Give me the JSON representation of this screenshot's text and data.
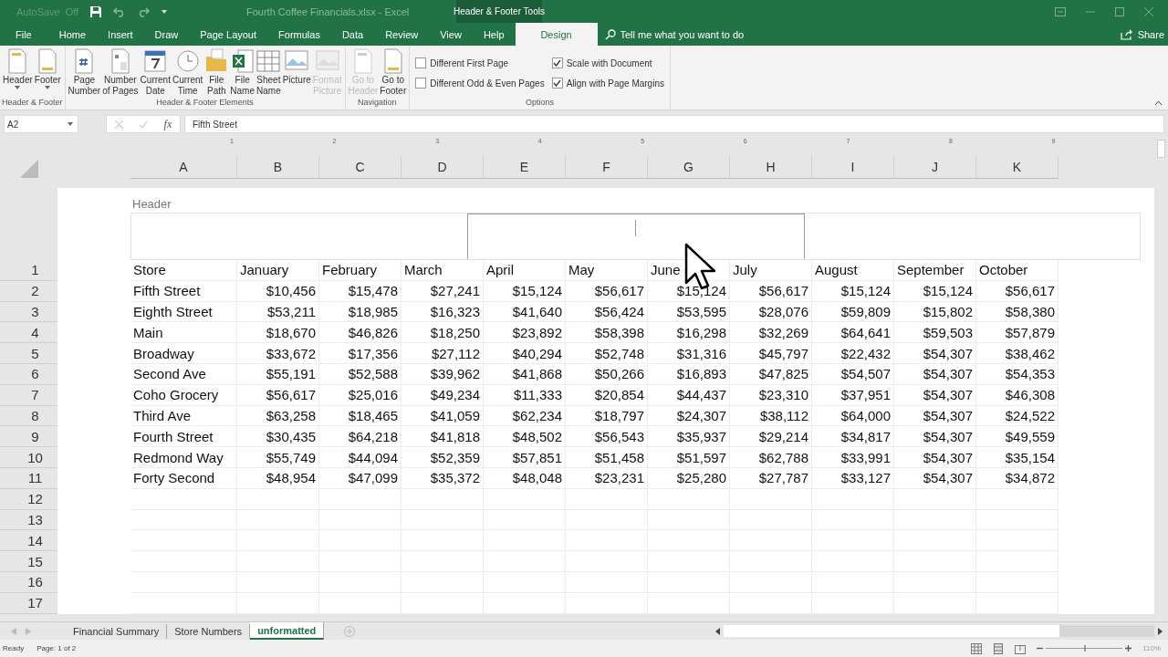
{
  "title_bar": {
    "autosave": {
      "label": "AutoSave",
      "state": "Off"
    },
    "title": "Fourth Coffee Financials.xlsx  -  Excel",
    "context": "Header & Footer Tools"
  },
  "tabs": [
    {
      "label": "File",
      "selected": false
    },
    {
      "label": "Home",
      "selected": false
    },
    {
      "label": "Insert",
      "selected": false
    },
    {
      "label": "Draw",
      "selected": false
    },
    {
      "label": "Page Layout",
      "selected": false
    },
    {
      "label": "Formulas",
      "selected": false
    },
    {
      "label": "Data",
      "selected": false
    },
    {
      "label": "Review",
      "selected": false
    },
    {
      "label": "View",
      "selected": false
    },
    {
      "label": "Help",
      "selected": false
    },
    {
      "label": "Design",
      "selected": true
    }
  ],
  "tell_me": {
    "placeholder": "Tell me what you want to do"
  },
  "share": "Share",
  "ribbon": {
    "groups": [
      {
        "label": "Header & Footer",
        "buttons": [
          {
            "label": "Header",
            "dropdown": true,
            "disabled": false
          },
          {
            "label": "Footer",
            "dropdown": true,
            "disabled": false
          }
        ]
      },
      {
        "label": "Header & Footer Elements",
        "buttons": [
          {
            "label": "Page\nNumber",
            "dropdown": false,
            "disabled": false
          },
          {
            "label": "Number\nof Pages",
            "dropdown": false,
            "disabled": false
          },
          {
            "label": "Current\nDate",
            "dropdown": false,
            "disabled": false
          },
          {
            "label": "Current\nTime",
            "dropdown": false,
            "disabled": false
          },
          {
            "label": "File\nPath",
            "dropdown": false,
            "disabled": false
          },
          {
            "label": "File\nName",
            "dropdown": false,
            "disabled": false
          },
          {
            "label": "Sheet\nName",
            "dropdown": false,
            "disabled": false
          },
          {
            "label": "Picture",
            "dropdown": false,
            "disabled": false
          },
          {
            "label": "Format\nPicture",
            "dropdown": false,
            "disabled": true
          }
        ]
      },
      {
        "label": "Navigation",
        "buttons": [
          {
            "label": "Go to\nHeader",
            "dropdown": false,
            "disabled": true
          },
          {
            "label": "Go to\nFooter",
            "dropdown": false,
            "disabled": false
          }
        ]
      }
    ],
    "options": {
      "label": "Options",
      "checks": [
        {
          "label": "Different First Page",
          "checked": false
        },
        {
          "label": "Different Odd & Even Pages",
          "checked": false
        },
        {
          "label": "Scale with Document",
          "checked": true
        },
        {
          "label": "Align with Page Margins",
          "checked": true
        }
      ]
    }
  },
  "formula_bar": {
    "name_box": "A2",
    "fx": "fx",
    "value": "Fifth Street"
  },
  "sheet": {
    "ruler": [
      "1",
      "2",
      "3",
      "4",
      "5",
      "6",
      "7",
      "8",
      "9"
    ],
    "columns": [
      "A",
      "B",
      "C",
      "D",
      "E",
      "F",
      "G",
      "H",
      "I",
      "J",
      "K"
    ],
    "header_label": "Header",
    "rows": [
      {
        "number": "1",
        "kind": "header",
        "cells": [
          "Store",
          "January",
          "February",
          "March",
          "April",
          "May",
          "June",
          "July",
          "August",
          "September",
          "October"
        ]
      },
      {
        "number": "2",
        "kind": "data",
        "cells": [
          "Fifth Street",
          "$10,456",
          "$15,478",
          "$27,241",
          "$15,124",
          "$56,617",
          "$15,124",
          "$56,617",
          "$15,124",
          "$15,124",
          "$56,617"
        ]
      },
      {
        "number": "3",
        "kind": "data",
        "cells": [
          "Eighth Street",
          "$53,211",
          "$18,985",
          "$16,323",
          "$41,640",
          "$56,424",
          "$53,595",
          "$28,076",
          "$59,809",
          "$15,802",
          "$58,380"
        ]
      },
      {
        "number": "4",
        "kind": "data",
        "cells": [
          "Main",
          "$18,670",
          "$46,826",
          "$18,250",
          "$23,892",
          "$58,398",
          "$16,298",
          "$32,269",
          "$64,641",
          "$59,503",
          "$57,879"
        ]
      },
      {
        "number": "5",
        "kind": "data",
        "cells": [
          "Broadway",
          "$33,672",
          "$17,356",
          "$27,112",
          "$40,294",
          "$52,748",
          "$31,316",
          "$45,797",
          "$22,432",
          "$54,307",
          "$38,462"
        ]
      },
      {
        "number": "6",
        "kind": "data",
        "cells": [
          "Second Ave",
          "$55,191",
          "$52,588",
          "$39,962",
          "$41,868",
          "$50,266",
          "$16,893",
          "$47,825",
          "$54,507",
          "$54,307",
          "$54,353"
        ]
      },
      {
        "number": "7",
        "kind": "data",
        "cells": [
          "Coho Grocery",
          "$56,617",
          "$25,016",
          "$49,234",
          "$11,333",
          "$20,854",
          "$44,437",
          "$23,310",
          "$37,951",
          "$54,307",
          "$46,308"
        ]
      },
      {
        "number": "8",
        "kind": "data",
        "cells": [
          "Third Ave",
          "$63,258",
          "$18,465",
          "$41,059",
          "$62,234",
          "$18,797",
          "$24,307",
          "$38,112",
          "$64,000",
          "$54,307",
          "$24,522"
        ]
      },
      {
        "number": "9",
        "kind": "data",
        "cells": [
          "Fourth Street",
          "$30,435",
          "$64,218",
          "$41,818",
          "$48,502",
          "$56,543",
          "$35,937",
          "$29,214",
          "$34,817",
          "$54,307",
          "$49,559"
        ]
      },
      {
        "number": "10",
        "kind": "data",
        "cells": [
          "Redmond Way",
          "$55,749",
          "$44,094",
          "$52,359",
          "$57,851",
          "$51,458",
          "$51,597",
          "$62,788",
          "$33,991",
          "$54,307",
          "$35,154"
        ]
      },
      {
        "number": "11",
        "kind": "data",
        "cells": [
          "Forty Second",
          "$48,954",
          "$47,099",
          "$35,372",
          "$48,048",
          "$23,231",
          "$25,280",
          "$27,787",
          "$33,127",
          "$54,307",
          "$34,872"
        ]
      },
      {
        "number": "12"
      },
      {
        "number": "13"
      },
      {
        "number": "14"
      },
      {
        "number": "15"
      },
      {
        "number": "16"
      },
      {
        "number": "17"
      }
    ]
  },
  "sheet_tabs": [
    {
      "label": "Financial Summary",
      "selected": false
    },
    {
      "label": "Store Numbers",
      "selected": false
    },
    {
      "label": "unformatted",
      "selected": true
    }
  ],
  "status_bar": {
    "status": "Ready",
    "page": "Page: 1 of 2",
    "zoom": "110%",
    "zoom_slider": {
      "level": 0.5
    }
  }
}
